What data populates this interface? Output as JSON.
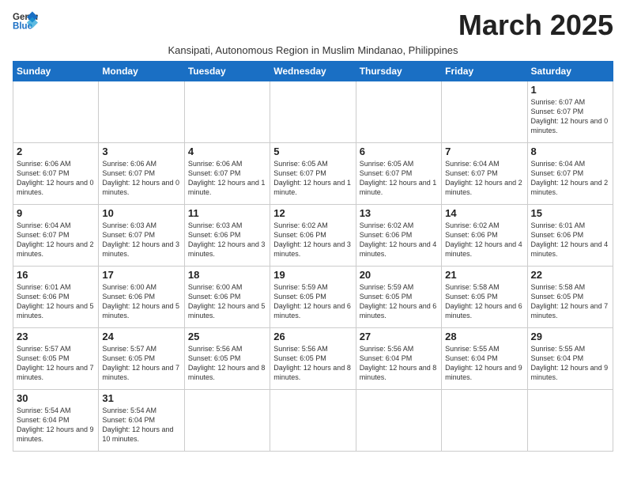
{
  "header": {
    "logo_line1": "General",
    "logo_line2": "Blue",
    "month_title": "March 2025",
    "subtitle": "Kansipati, Autonomous Region in Muslim Mindanao, Philippines"
  },
  "weekdays": [
    "Sunday",
    "Monday",
    "Tuesday",
    "Wednesday",
    "Thursday",
    "Friday",
    "Saturday"
  ],
  "weeks": [
    [
      {
        "day": "",
        "info": ""
      },
      {
        "day": "",
        "info": ""
      },
      {
        "day": "",
        "info": ""
      },
      {
        "day": "",
        "info": ""
      },
      {
        "day": "",
        "info": ""
      },
      {
        "day": "",
        "info": ""
      },
      {
        "day": "1",
        "info": "Sunrise: 6:07 AM\nSunset: 6:07 PM\nDaylight: 12 hours\nand 0 minutes."
      }
    ],
    [
      {
        "day": "2",
        "info": "Sunrise: 6:06 AM\nSunset: 6:07 PM\nDaylight: 12 hours\nand 0 minutes."
      },
      {
        "day": "3",
        "info": "Sunrise: 6:06 AM\nSunset: 6:07 PM\nDaylight: 12 hours\nand 0 minutes."
      },
      {
        "day": "4",
        "info": "Sunrise: 6:06 AM\nSunset: 6:07 PM\nDaylight: 12 hours\nand 1 minute."
      },
      {
        "day": "5",
        "info": "Sunrise: 6:05 AM\nSunset: 6:07 PM\nDaylight: 12 hours\nand 1 minute."
      },
      {
        "day": "6",
        "info": "Sunrise: 6:05 AM\nSunset: 6:07 PM\nDaylight: 12 hours\nand 1 minute."
      },
      {
        "day": "7",
        "info": "Sunrise: 6:04 AM\nSunset: 6:07 PM\nDaylight: 12 hours\nand 2 minutes."
      },
      {
        "day": "8",
        "info": "Sunrise: 6:04 AM\nSunset: 6:07 PM\nDaylight: 12 hours\nand 2 minutes."
      }
    ],
    [
      {
        "day": "9",
        "info": "Sunrise: 6:04 AM\nSunset: 6:07 PM\nDaylight: 12 hours\nand 2 minutes."
      },
      {
        "day": "10",
        "info": "Sunrise: 6:03 AM\nSunset: 6:07 PM\nDaylight: 12 hours\nand 3 minutes."
      },
      {
        "day": "11",
        "info": "Sunrise: 6:03 AM\nSunset: 6:06 PM\nDaylight: 12 hours\nand 3 minutes."
      },
      {
        "day": "12",
        "info": "Sunrise: 6:02 AM\nSunset: 6:06 PM\nDaylight: 12 hours\nand 3 minutes."
      },
      {
        "day": "13",
        "info": "Sunrise: 6:02 AM\nSunset: 6:06 PM\nDaylight: 12 hours\nand 4 minutes."
      },
      {
        "day": "14",
        "info": "Sunrise: 6:02 AM\nSunset: 6:06 PM\nDaylight: 12 hours\nand 4 minutes."
      },
      {
        "day": "15",
        "info": "Sunrise: 6:01 AM\nSunset: 6:06 PM\nDaylight: 12 hours\nand 4 minutes."
      }
    ],
    [
      {
        "day": "16",
        "info": "Sunrise: 6:01 AM\nSunset: 6:06 PM\nDaylight: 12 hours\nand 5 minutes."
      },
      {
        "day": "17",
        "info": "Sunrise: 6:00 AM\nSunset: 6:06 PM\nDaylight: 12 hours\nand 5 minutes."
      },
      {
        "day": "18",
        "info": "Sunrise: 6:00 AM\nSunset: 6:06 PM\nDaylight: 12 hours\nand 5 minutes."
      },
      {
        "day": "19",
        "info": "Sunrise: 5:59 AM\nSunset: 6:05 PM\nDaylight: 12 hours\nand 6 minutes."
      },
      {
        "day": "20",
        "info": "Sunrise: 5:59 AM\nSunset: 6:05 PM\nDaylight: 12 hours\nand 6 minutes."
      },
      {
        "day": "21",
        "info": "Sunrise: 5:58 AM\nSunset: 6:05 PM\nDaylight: 12 hours\nand 6 minutes."
      },
      {
        "day": "22",
        "info": "Sunrise: 5:58 AM\nSunset: 6:05 PM\nDaylight: 12 hours\nand 7 minutes."
      }
    ],
    [
      {
        "day": "23",
        "info": "Sunrise: 5:57 AM\nSunset: 6:05 PM\nDaylight: 12 hours\nand 7 minutes."
      },
      {
        "day": "24",
        "info": "Sunrise: 5:57 AM\nSunset: 6:05 PM\nDaylight: 12 hours\nand 7 minutes."
      },
      {
        "day": "25",
        "info": "Sunrise: 5:56 AM\nSunset: 6:05 PM\nDaylight: 12 hours\nand 8 minutes."
      },
      {
        "day": "26",
        "info": "Sunrise: 5:56 AM\nSunset: 6:05 PM\nDaylight: 12 hours\nand 8 minutes."
      },
      {
        "day": "27",
        "info": "Sunrise: 5:56 AM\nSunset: 6:04 PM\nDaylight: 12 hours\nand 8 minutes."
      },
      {
        "day": "28",
        "info": "Sunrise: 5:55 AM\nSunset: 6:04 PM\nDaylight: 12 hours\nand 9 minutes."
      },
      {
        "day": "29",
        "info": "Sunrise: 5:55 AM\nSunset: 6:04 PM\nDaylight: 12 hours\nand 9 minutes."
      }
    ],
    [
      {
        "day": "30",
        "info": "Sunrise: 5:54 AM\nSunset: 6:04 PM\nDaylight: 12 hours\nand 9 minutes."
      },
      {
        "day": "31",
        "info": "Sunrise: 5:54 AM\nSunset: 6:04 PM\nDaylight: 12 hours\nand 10 minutes."
      },
      {
        "day": "",
        "info": ""
      },
      {
        "day": "",
        "info": ""
      },
      {
        "day": "",
        "info": ""
      },
      {
        "day": "",
        "info": ""
      },
      {
        "day": "",
        "info": ""
      }
    ]
  ]
}
